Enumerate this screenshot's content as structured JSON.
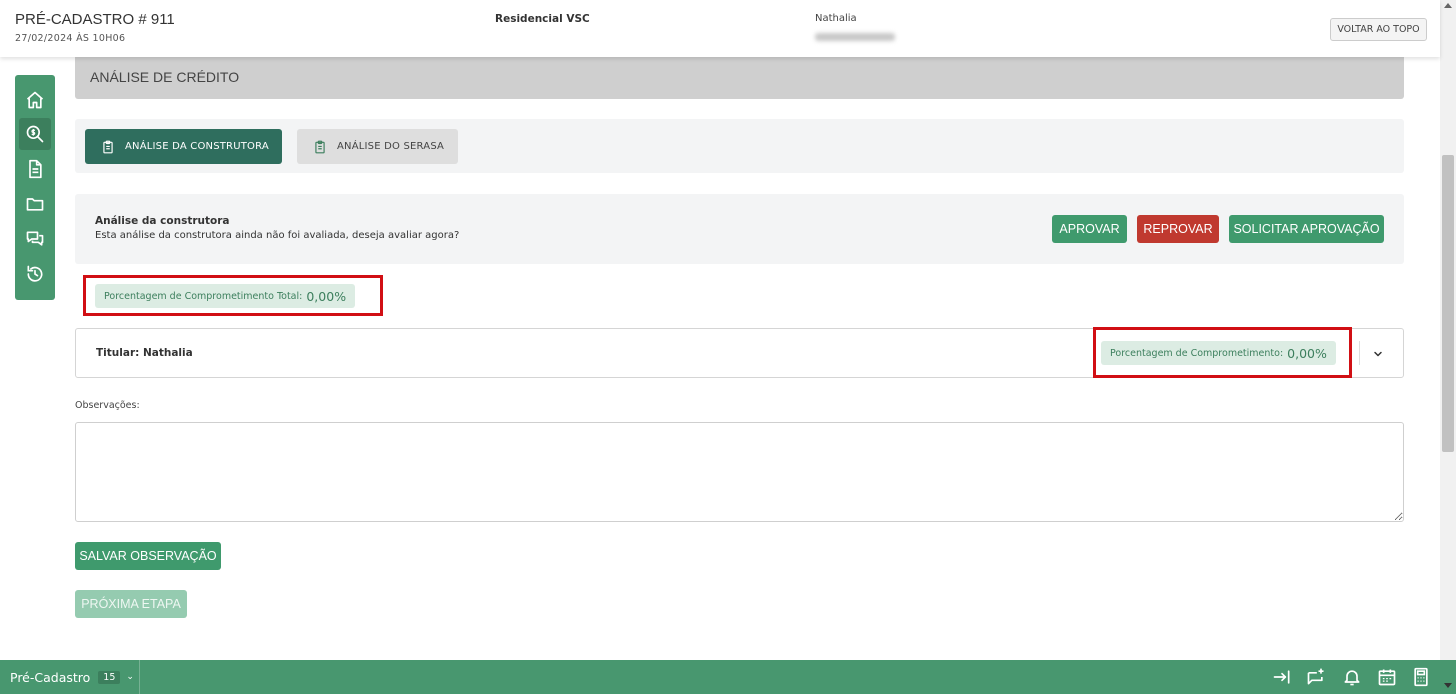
{
  "header": {
    "title": "PRÉ-CADASTRO # 911",
    "date": "27/02/2024 ÀS 10H06",
    "project": "Residencial VSC",
    "client_name": "Nathalia",
    "back_to_top": "VOLTAR AO TOPO"
  },
  "sidenav": {
    "items": [
      {
        "icon": "home-icon"
      },
      {
        "icon": "credit-analysis-icon",
        "active": true
      },
      {
        "icon": "document-icon"
      },
      {
        "icon": "folder-icon"
      },
      {
        "icon": "chat-icon"
      },
      {
        "icon": "history-icon"
      }
    ]
  },
  "section": {
    "title": "ANÁLISE DE CRÉDITO"
  },
  "tabs": [
    {
      "label": "ANÁLISE DA CONSTRUTORA",
      "active": true
    },
    {
      "label": "ANÁLISE DO SERASA",
      "active": false
    }
  ],
  "analysis": {
    "title": "Análise da construtora",
    "description": "Esta análise da construtora ainda não foi avaliada, deseja avaliar agora?",
    "approve": "APROVAR",
    "reject": "REPROVAR",
    "request": "SOLICITAR APROVAÇÃO"
  },
  "total_commitment": {
    "label": "Porcentagem de Comprometimento Total:",
    "value": "0,00%"
  },
  "holder": {
    "label": "Titular: Nathalia",
    "commitment_label": "Porcentagem de Comprometimento:",
    "commitment_value": "0,00%"
  },
  "observations": {
    "label": "Observações:",
    "value": ""
  },
  "buttons": {
    "save": "SALVAR OBSERVAÇÃO",
    "next": "PRÓXIMA ETAPA"
  },
  "bottombar": {
    "tab_label": "Pré-Cadastro",
    "count": "15"
  },
  "colors": {
    "primary": "#48976f",
    "dark_green": "#2f6e5e",
    "danger": "#c0392f",
    "highlight": "#d10f14"
  }
}
